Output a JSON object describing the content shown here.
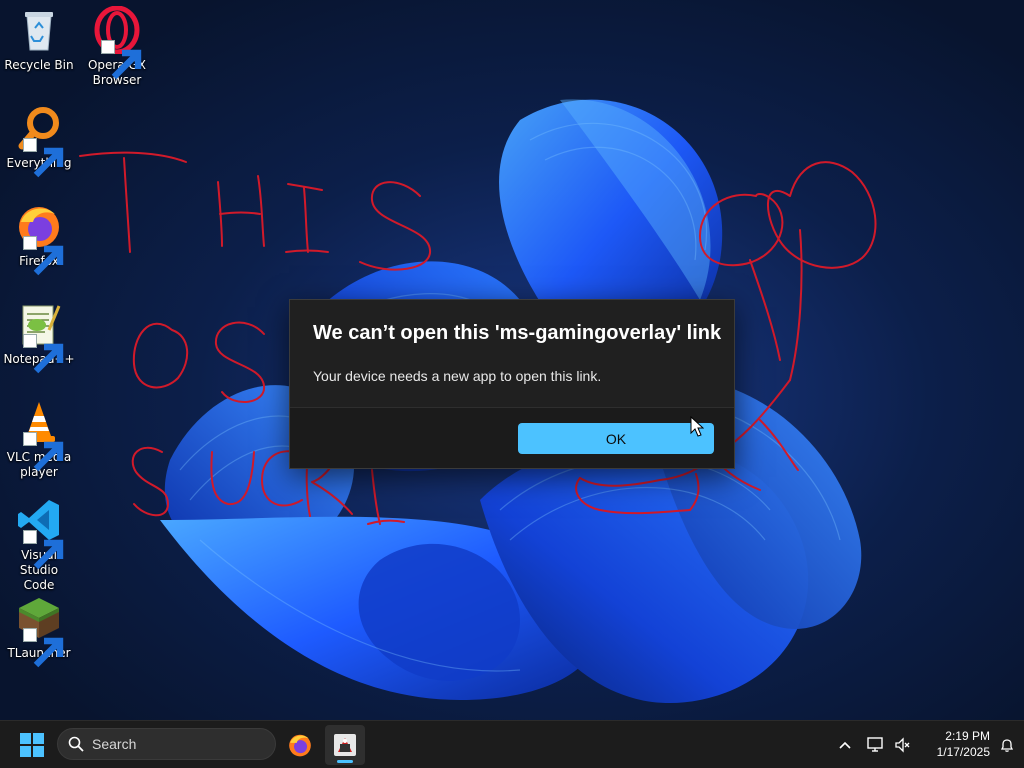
{
  "desktop": {
    "icons": [
      {
        "label": "Recycle Bin",
        "icon": "recycle-bin-icon",
        "shortcut": false
      },
      {
        "label": "Opera GX\nBrowser",
        "icon": "opera-gx-icon",
        "shortcut": true
      },
      {
        "label": "Everything",
        "icon": "everything-search-icon",
        "shortcut": true
      },
      {
        "label": "Firefox",
        "icon": "firefox-icon",
        "shortcut": true
      },
      {
        "label": "Notepad++",
        "icon": "notepad-plus-plus-icon",
        "shortcut": true
      },
      {
        "label": "VLC media\nplayer",
        "icon": "vlc-cone-icon",
        "shortcut": true
      },
      {
        "label": "Visual Studio\nCode",
        "icon": "vscode-icon",
        "shortcut": true
      },
      {
        "label": "TLauncher",
        "icon": "tlauncher-grass-block-icon",
        "shortcut": true
      }
    ],
    "scribble_color": "#d11a2a"
  },
  "dialog": {
    "title": "We can’t open this 'ms-gamingoverlay' link",
    "message": "Your device needs a new app to open this link.",
    "ok_label": "OK",
    "accent": "#4cc2ff"
  },
  "taskbar": {
    "search_label": "Search",
    "apps": [
      {
        "icon": "firefox-icon",
        "active": false
      },
      {
        "icon": "app-window-icon",
        "active": true
      }
    ],
    "tray": {
      "time": "2:19 PM",
      "date": "1/17/2025",
      "icons": [
        "chevron-up-icon",
        "monitor-icon",
        "volume-muted-icon",
        "notification-bell-icon"
      ]
    }
  }
}
